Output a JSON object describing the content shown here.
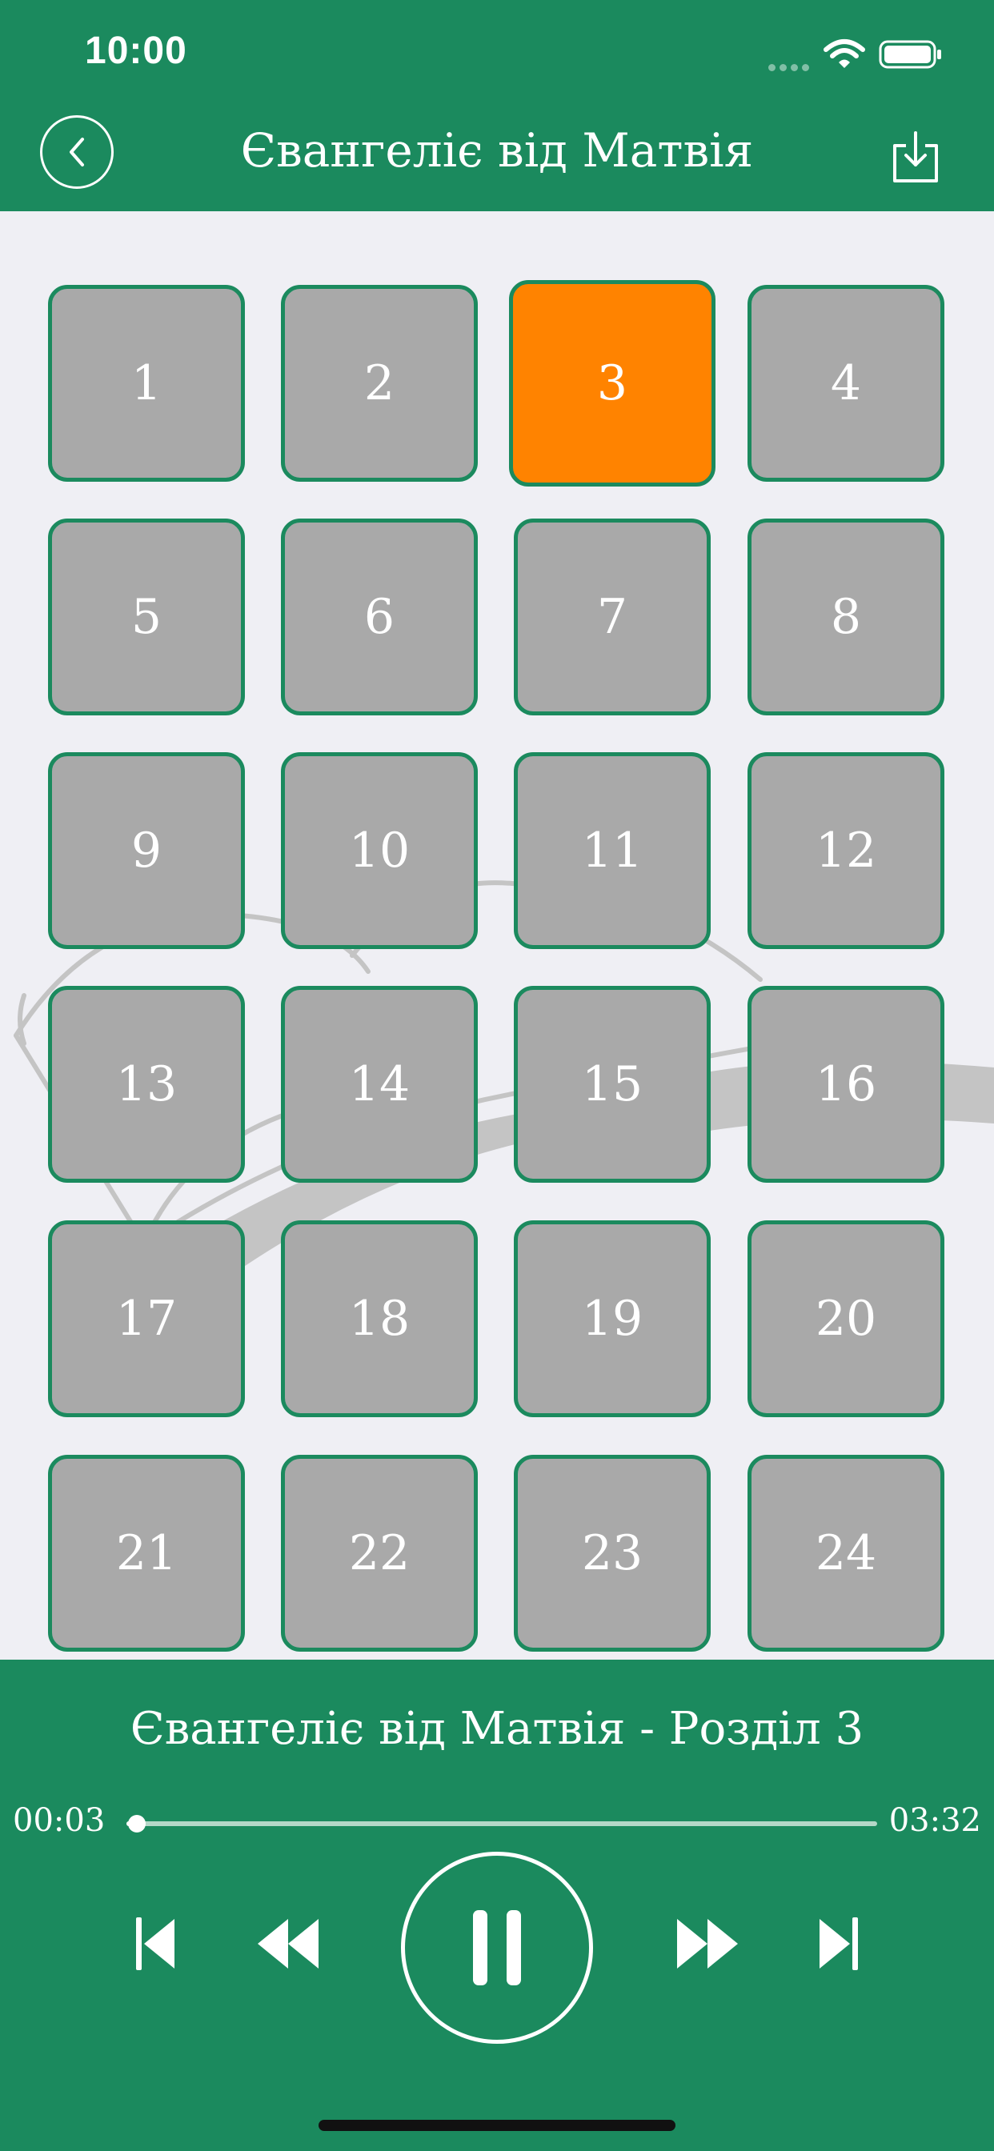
{
  "status_bar": {
    "time": "10:00"
  },
  "nav": {
    "title": "Євангеліє від Матвія",
    "back_icon": "chevron-left-icon",
    "download_icon": "download-icon"
  },
  "chapters": [
    "1",
    "2",
    "3",
    "4",
    "5",
    "6",
    "7",
    "8",
    "9",
    "10",
    "11",
    "12",
    "13",
    "14",
    "15",
    "16",
    "17",
    "18",
    "19",
    "20",
    "21",
    "22",
    "23",
    "24"
  ],
  "active_chapter": "3",
  "player": {
    "track_title": "Євангеліє від Матвія - Розділ 3",
    "current_time": "00:03",
    "total_time": "03:32",
    "progress": 0.014,
    "state": "playing"
  },
  "colors": {
    "primary": "#1b8a5e",
    "active": "#ff8300",
    "tile": "#a9a9a9",
    "background": "#efeff4"
  }
}
